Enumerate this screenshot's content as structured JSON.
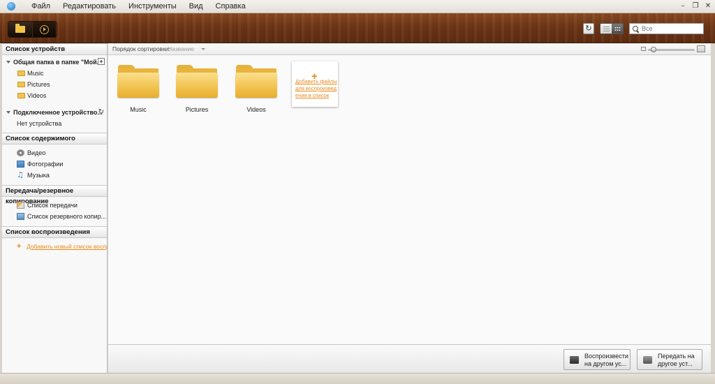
{
  "menu": {
    "items": [
      "Файл",
      "Редактировать",
      "Инструменты",
      "Вид",
      "Справка"
    ]
  },
  "toolbar": {
    "search_placeholder": "Все"
  },
  "sidebar": {
    "device_list_header": "Список устройств",
    "shared_folder": {
      "label": "Общая папка в папке \"Мой...",
      "children": [
        "Music",
        "Pictures",
        "Videos"
      ]
    },
    "connected_device": {
      "label": "Подключенное устройство...",
      "empty_text": "Нет устройства"
    },
    "content_header": "Список содержимого",
    "content_items": [
      "Видео",
      "Фотографии",
      "Музыка"
    ],
    "transfer_header": "Передача/резервное копирование",
    "transfer_items": [
      "Список передачи",
      "Список резервного копир..."
    ],
    "playlist_header": "Список воспроизведения",
    "add_playlist_link": "Добавить новый список воспр..."
  },
  "main": {
    "sort_label": "Порядок сортировки:",
    "sort_value": "Название",
    "folders": [
      "Music",
      "Pictures",
      "Videos"
    ],
    "add_tile_text": "Добавить файлы для воспроизведения в список"
  },
  "bottom": {
    "play_on_device": "Воспроизвести на другом ус...",
    "transfer": "Передать на другое уст..."
  },
  "colors": {
    "accent_orange": "#e88a1a",
    "wood_dark": "#6e3616",
    "folder_yellow": "#f1c24d"
  }
}
